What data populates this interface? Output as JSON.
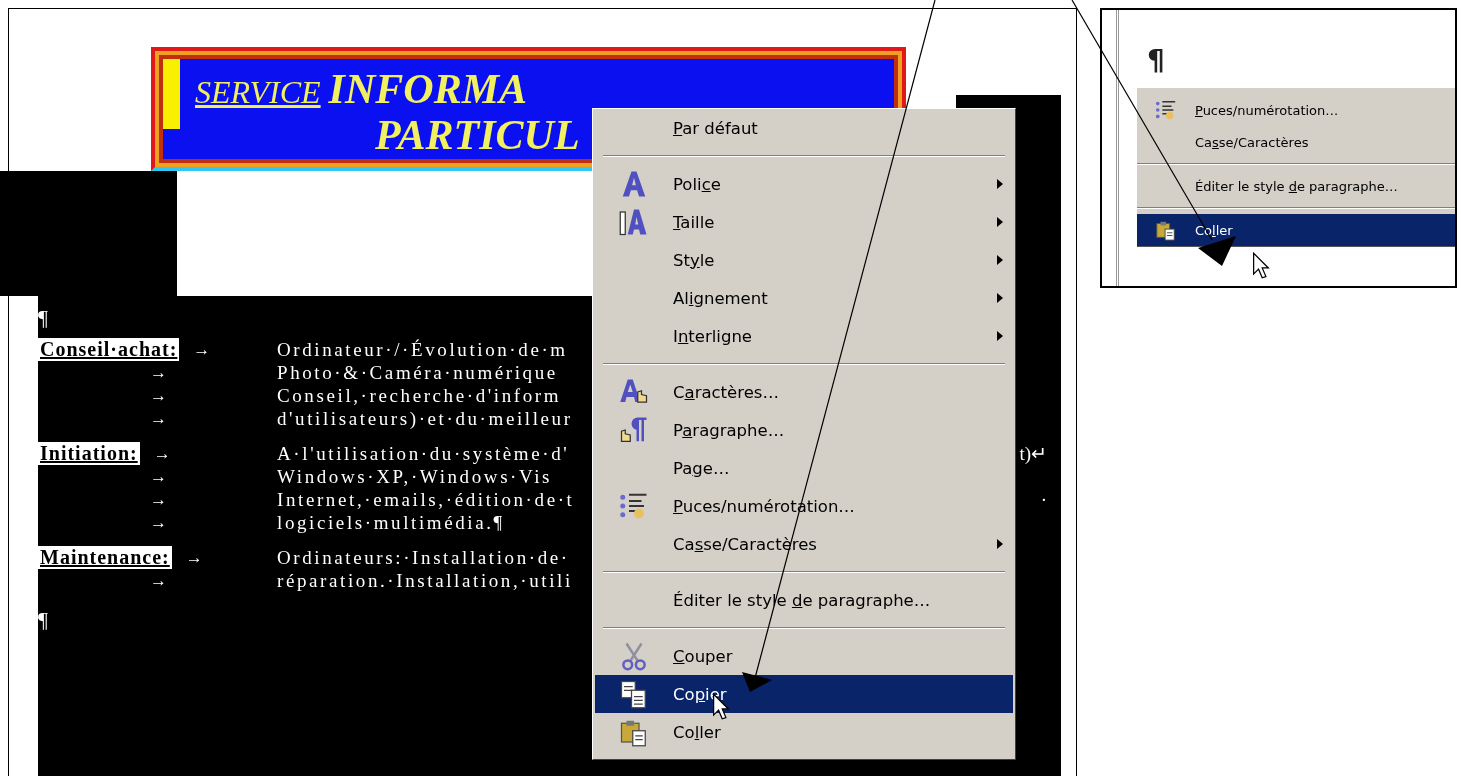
{
  "banner": {
    "small_word": "SERVICE",
    "big_word": "INFORMA",
    "line_2": "PARTICUL"
  },
  "document": {
    "top_mark": "¶",
    "sections": [
      {
        "label": "Conseil·achat:",
        "lines": [
          {
            "tab": "→",
            "text": "Ordinateur·/·Évolution·de·m"
          },
          {
            "tab": "→",
            "text": "Photo·&·Caméra·numérique"
          },
          {
            "tab": "→",
            "text": "Conseil,·recherche·d'inform"
          },
          {
            "tab": "→",
            "text": "d'utilisateurs)·et·du·meilleur"
          }
        ]
      },
      {
        "label": "Initiation:",
        "lines": [
          {
            "tab": "→",
            "text": "A·l'utilisation·du·système·d'",
            "tail": "t)↵"
          },
          {
            "tab": "→",
            "text": "Windows·XP,·Windows·Vis"
          },
          {
            "tab": "→",
            "text": "Internet,·emails,·édition·de·t",
            "tail": "·"
          },
          {
            "tab": "→",
            "text": "logiciels·multimédia.¶"
          }
        ]
      },
      {
        "label": "Maintenance:",
        "lines": [
          {
            "tab": "→",
            "text": "Ordinateurs:·Installation·de·"
          },
          {
            "tab": "→",
            "text": "réparation.·Installation,·utili"
          }
        ]
      }
    ],
    "end_mark": "¶"
  },
  "context_menu": [
    {
      "kind": "plain",
      "key": "P",
      "post": "ar défaut",
      "submenu": false,
      "selected": false
    },
    {
      "kind": "separator"
    },
    {
      "kind": "font",
      "pre": "Poli",
      "key": "c",
      "post": "e",
      "submenu": true,
      "selected": false
    },
    {
      "kind": "size",
      "key": "T",
      "post": "aille",
      "submenu": true,
      "selected": false
    },
    {
      "kind": "plain",
      "pre": "St",
      "key": "y",
      "post": "le",
      "submenu": true,
      "selected": false
    },
    {
      "kind": "plain",
      "pre": "Al",
      "key": "i",
      "post": "gnement",
      "submenu": true,
      "selected": false
    },
    {
      "kind": "plain",
      "pre": "I",
      "key": "n",
      "post": "terligne",
      "submenu": true,
      "selected": false
    },
    {
      "kind": "separator"
    },
    {
      "kind": "characters",
      "pre": "C",
      "key": "a",
      "post": "ractères…",
      "submenu": false,
      "selected": false
    },
    {
      "kind": "paragraph",
      "pre": "P",
      "key": "a",
      "post": "ragraphe…",
      "submenu": false,
      "selected": false
    },
    {
      "kind": "plain",
      "pre": "Pa",
      "key": "g",
      "post": "e…",
      "submenu": false,
      "selected": false
    },
    {
      "kind": "bullets",
      "key": "P",
      "post": "uces/numérotation…",
      "submenu": false,
      "selected": false
    },
    {
      "kind": "plain",
      "pre": "Ca",
      "key": "s",
      "post": "se/Caractères",
      "submenu": true,
      "selected": false
    },
    {
      "kind": "separator"
    },
    {
      "kind": "plain",
      "pre": "Éditer le style ",
      "key": "d",
      "post": "e paragraphe…",
      "submenu": false,
      "selected": false
    },
    {
      "kind": "separator"
    },
    {
      "kind": "cut",
      "key": "C",
      "post": "ouper",
      "submenu": false,
      "selected": false
    },
    {
      "kind": "copy",
      "pre": "Co",
      "key": "p",
      "post": "ier",
      "submenu": false,
      "selected": true
    },
    {
      "kind": "paste",
      "pre": "Co",
      "key": "l",
      "post": "ler",
      "submenu": false,
      "selected": false
    }
  ],
  "inset": {
    "mark": "¶",
    "menu": [
      {
        "kind": "bullets",
        "key": "P",
        "post": "uces/numérotation…",
        "selected": false
      },
      {
        "kind": "plain",
        "pre": "Ca",
        "key": "s",
        "post": "se/Caractères",
        "selected": false
      },
      {
        "kind": "separator"
      },
      {
        "kind": "plain",
        "pre": "Éditer le style ",
        "key": "d",
        "post": "e paragraphe…",
        "selected": false
      },
      {
        "kind": "separator"
      },
      {
        "kind": "paste",
        "pre": "Co",
        "key": "l",
        "post": "ler",
        "selected": true
      }
    ]
  }
}
